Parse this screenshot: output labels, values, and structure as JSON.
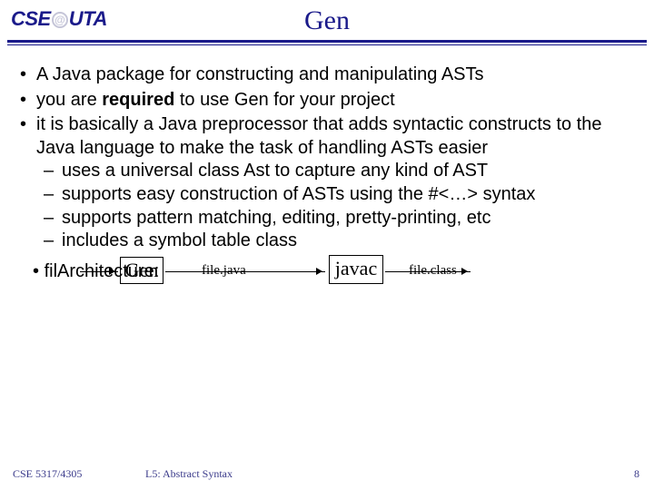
{
  "header": {
    "logo_left": "CSE",
    "logo_at": "@",
    "logo_right": "UTA",
    "title": "Gen"
  },
  "bullets": {
    "b1": "A Java package for constructing and manipulating ASTs",
    "b2_pre": "you are ",
    "b2_req": "required",
    "b2_post": " to use Gen for your project",
    "b3": "it is basically a Java preprocessor that adds syntactic constructs to the Java language to make the task of handling ASTs easier",
    "s1": "uses a universal class Ast to capture any kind of AST",
    "s2": "supports easy construction of ASTs using the #<…> syntax",
    "s3": "supports pattern matching, editing, pretty-printing, etc",
    "s4": "includes a symbol table class",
    "b4_overlap": "filArchitecture:",
    "b4_filegen": "file.gen"
  },
  "flow": {
    "box_gen": "Gen",
    "label_java": "file.java",
    "box_javac": "javac",
    "label_class": "file.class"
  },
  "footer": {
    "course": "CSE 5317/4305",
    "lecture": "L5: Abstract Syntax",
    "page": "8"
  }
}
